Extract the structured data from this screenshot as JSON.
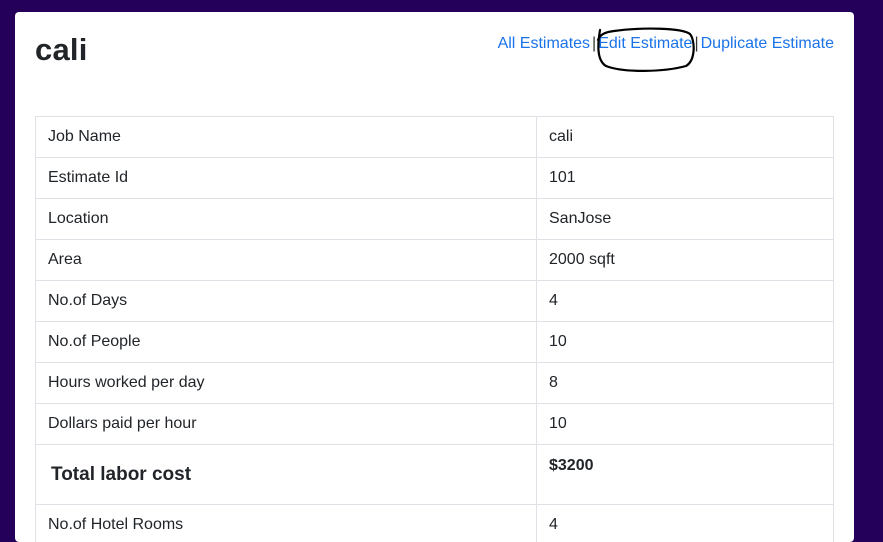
{
  "page": {
    "title": "cali"
  },
  "nav": {
    "all_estimates": "All Estimates",
    "separator": "|",
    "edit_estimate": "Edit Estimate",
    "duplicate_estimate": "Duplicate Estimate"
  },
  "details": {
    "rows": [
      {
        "label": "Job Name",
        "value": "cali"
      },
      {
        "label": "Estimate Id",
        "value": "101"
      },
      {
        "label": "Location",
        "value": "SanJose"
      },
      {
        "label": "Area",
        "value": "2000 sqft"
      },
      {
        "label": "No.of Days",
        "value": "4"
      },
      {
        "label": "No.of People",
        "value": "10"
      },
      {
        "label": "Hours worked per day",
        "value": "8"
      },
      {
        "label": "Dollars paid per hour",
        "value": "10"
      },
      {
        "label": "Total labor cost",
        "value": "$3200"
      },
      {
        "label": "No.of Hotel Rooms",
        "value": "4"
      }
    ]
  },
  "colors": {
    "background": "#24005a",
    "link": "#1a73e8",
    "annotation": "#000000"
  }
}
